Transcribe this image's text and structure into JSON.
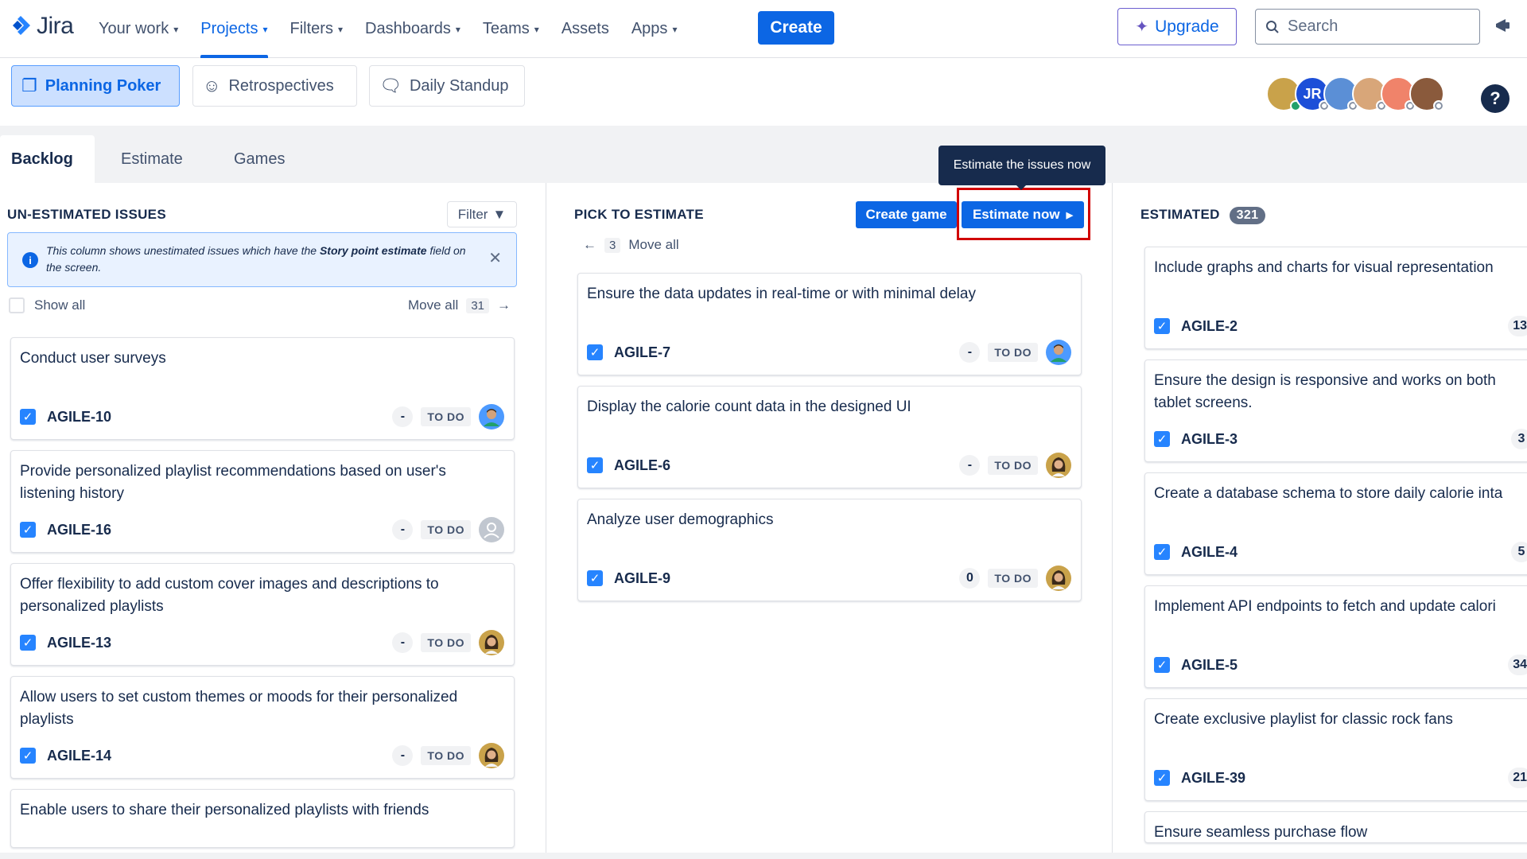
{
  "topnav": {
    "logo_text": "Jira",
    "items": [
      {
        "label": "Your work",
        "dropdown": true
      },
      {
        "label": "Projects",
        "dropdown": true,
        "active": true
      },
      {
        "label": "Filters",
        "dropdown": true
      },
      {
        "label": "Dashboards",
        "dropdown": true
      },
      {
        "label": "Teams",
        "dropdown": true
      },
      {
        "label": "Assets",
        "dropdown": false
      },
      {
        "label": "Apps",
        "dropdown": true
      }
    ],
    "create_label": "Create",
    "upgrade_label": "Upgrade",
    "search_placeholder": "Search"
  },
  "apps": {
    "planning_poker": "Planning Poker",
    "retrospectives": "Retrospectives",
    "daily_standup": "Daily Standup"
  },
  "avatars": {
    "initials": "JR"
  },
  "help_label": "?",
  "tabs": {
    "backlog": "Backlog",
    "estimate": "Estimate",
    "games": "Games"
  },
  "tooltip": "Estimate the issues now",
  "unestimated": {
    "title": "UN-ESTIMATED ISSUES",
    "filter_label": "Filter",
    "info_prefix": "This column shows unestimated issues which have the ",
    "info_bold": "Story point estimate",
    "info_suffix": " field on the screen.",
    "show_all_label": "Show all",
    "move_all_label": "Move all",
    "move_all_count": "31",
    "cards": [
      {
        "title": "Conduct user surveys",
        "key": "AGILE-10",
        "points": "-",
        "status": "TO DO",
        "avatar": "man"
      },
      {
        "title": "Provide personalized playlist recommendations based on user's listening history",
        "key": "AGILE-16",
        "points": "-",
        "status": "TO DO",
        "avatar": "default"
      },
      {
        "title": "Offer flexibility to add custom cover images and descriptions to personalized playlists",
        "key": "AGILE-13",
        "points": "-",
        "status": "TO DO",
        "avatar": "woman"
      },
      {
        "title": "Allow users to set custom themes or moods for their personalized playlists",
        "key": "AGILE-14",
        "points": "-",
        "status": "TO DO",
        "avatar": "woman"
      },
      {
        "title": "Enable users to share their personalized playlists with friends",
        "key": "",
        "points": "",
        "status": "",
        "avatar": ""
      }
    ]
  },
  "pick": {
    "title": "PICK TO ESTIMATE",
    "create_game_label": "Create game",
    "estimate_now_label": "Estimate now",
    "move_all_count": "3",
    "move_all_label": "Move all",
    "cards": [
      {
        "title": "Ensure the data updates in real-time or with minimal delay",
        "key": "AGILE-7",
        "points": "-",
        "status": "TO DO",
        "avatar": "man"
      },
      {
        "title": "Display the calorie count data in the designed UI",
        "key": "AGILE-6",
        "points": "-",
        "status": "TO DO",
        "avatar": "woman"
      },
      {
        "title": "Analyze user demographics",
        "key": "AGILE-9",
        "points": "0",
        "status": "TO DO",
        "avatar": "woman"
      }
    ]
  },
  "estimated": {
    "title": "ESTIMATED",
    "count": "321",
    "cards": [
      {
        "title": "Include graphs and charts for visual representation",
        "key": "AGILE-2",
        "points": "13"
      },
      {
        "title": "Ensure the design is responsive and works on both tablet screens.",
        "key": "AGILE-3",
        "points": "3"
      },
      {
        "title": "Create a database schema to store daily calorie inta",
        "key": "AGILE-4",
        "points": "5"
      },
      {
        "title": "Implement API endpoints to fetch and update calori",
        "key": "AGILE-5",
        "points": "34"
      },
      {
        "title": "Create exclusive playlist for classic rock fans",
        "key": "AGILE-39",
        "points": "21"
      },
      {
        "title": "Ensure seamless purchase flow",
        "key": "",
        "points": ""
      }
    ]
  },
  "colors": {
    "brand": "#0c66e4",
    "highlight": "#d10000",
    "info_bg": "#e9f2ff"
  }
}
